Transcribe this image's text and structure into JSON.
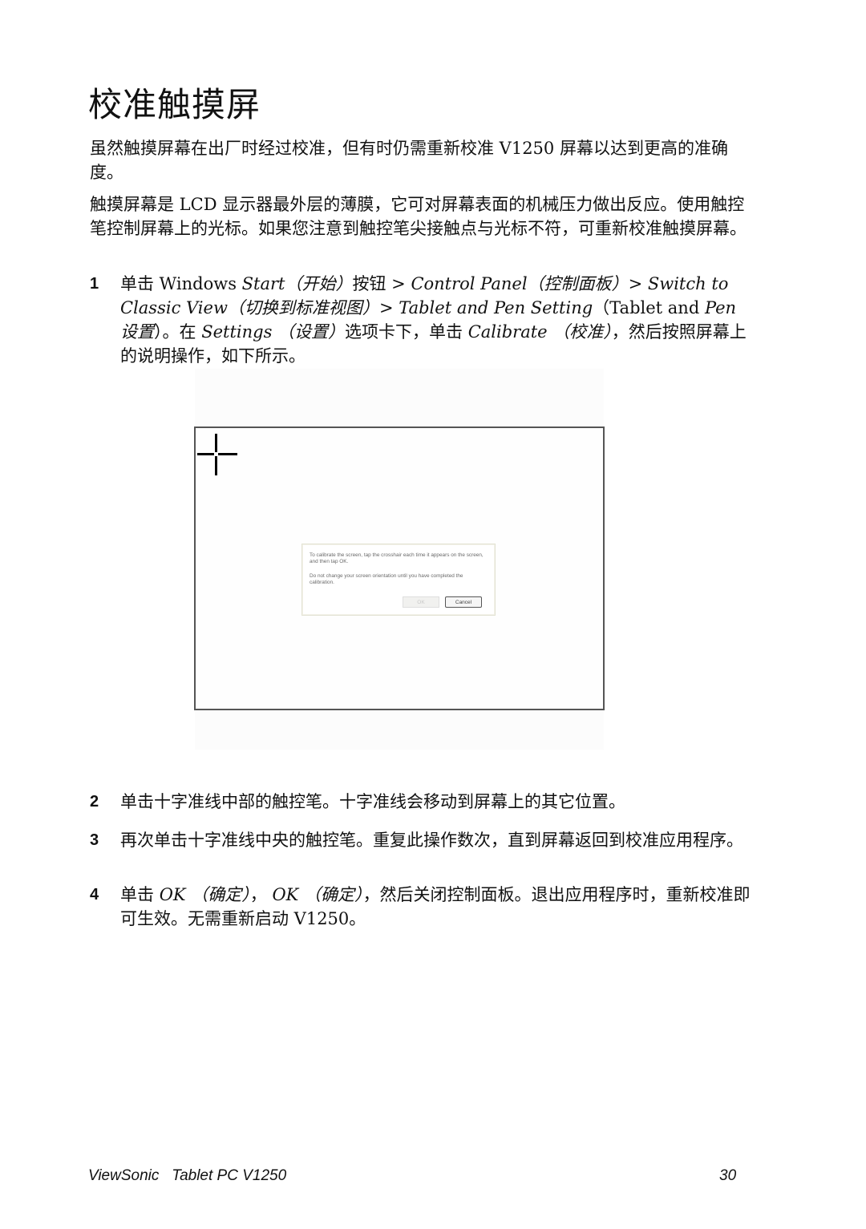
{
  "page": {
    "title": "校准触摸屏",
    "intro_paragraphs": [
      "虽然触摸屏幕在出厂时经过校准，但有时仍需重新校准 V1250 屏幕以达到更高的准确度。",
      "触摸屏幕是 LCD 显示器最外层的薄膜，它可对屏幕表面的机械压力做出反应。使用触控笔控制屏幕上的光标。如果您注意到触控笔尖接触点与光标不符，可重新校准触摸屏幕。"
    ],
    "steps": [
      {
        "number": "1",
        "segments": [
          {
            "text": "单击 Windows ",
            "italic": false
          },
          {
            "text": "Start（开始）",
            "italic": true
          },
          {
            "text": "按钮 > ",
            "italic": false
          },
          {
            "text": "Control Panel（控制面板）",
            "italic": true
          },
          {
            "text": "> ",
            "italic": false
          },
          {
            "text": "Switch to Classic View（切换到标准视图）",
            "italic": true
          },
          {
            "text": "> ",
            "italic": false
          },
          {
            "text": "Tablet and Pen Setting",
            "italic": true
          },
          {
            "text": "（Tablet and ",
            "italic": false
          },
          {
            "text": "Pen 设置",
            "italic": true
          },
          {
            "text": "）。在 ",
            "italic": false
          },
          {
            "text": "Settings （设置）",
            "italic": true
          },
          {
            "text": "选项卡下，单击 ",
            "italic": false
          },
          {
            "text": "Calibrate （校准）",
            "italic": true
          },
          {
            "text": "，然后按照屏幕上的说明操作，如下所示。",
            "italic": false
          }
        ]
      },
      {
        "number": "2",
        "segments": [
          {
            "text": "单击十字准线中部的触控笔。十字准线会移动到屏幕上的其它位置。",
            "italic": false
          }
        ]
      },
      {
        "number": "3",
        "segments": [
          {
            "text": "再次单击十字准线中央的触控笔。重复此操作数次，直到屏幕返回到校准应用程序。",
            "italic": false
          }
        ]
      },
      {
        "number": "4",
        "segments": [
          {
            "text": "单击 ",
            "italic": false
          },
          {
            "text": "OK （确定）",
            "italic": true
          },
          {
            "text": "， ",
            "italic": false
          },
          {
            "text": "OK （确定）",
            "italic": true
          },
          {
            "text": "，然后关闭控制面板。退出应用程序时，重新校准即可生效。无需重新启动 V1250。",
            "italic": false
          }
        ]
      }
    ]
  },
  "screenshot": {
    "crosshair_icon": "crosshair-icon",
    "dialog": {
      "message_1": "To calibrate the screen, tap the crosshair each time it appears on the screen, and then tap OK.",
      "message_2": "Do not change your screen orientation until you have completed the calibration.",
      "ok_label": "OK",
      "cancel_label": "Cancel"
    }
  },
  "footer": {
    "product": "ViewSonic   Tablet PC V1250",
    "page_number": "30"
  }
}
